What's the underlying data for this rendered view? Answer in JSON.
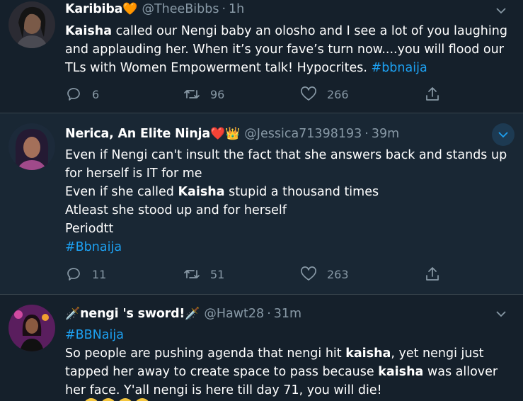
{
  "colors": {
    "background": "#15202b",
    "hover_background": "#192734",
    "text": "#ffffff",
    "muted": "#8899a6",
    "link": "#1da1f2",
    "divider": "#38444d"
  },
  "tweets": [
    {
      "name": "Karibiba",
      "name_emoji": "🧡",
      "handle": "@TheeBibbs",
      "time": "1h",
      "lines": [
        [
          "",
          "Kaisha",
          " called our Nengi baby an olosho and I see a lot of you laughing"
        ],
        [
          "and applauding her. When it’s your fave’s turn now....you will flood our",
          "",
          ""
        ],
        [
          "TLs with Women Empowerment talk! Hypocrites.  ",
          "",
          ""
        ]
      ],
      "hashtag": "#bbnaija",
      "replies": "6",
      "retweets": "96",
      "likes": "266",
      "icons": [
        "reply-icon",
        "retweet-icon",
        "like-icon",
        "share-icon",
        "chevron-down-icon"
      ]
    },
    {
      "name": "Nerica, An Elite Ninja",
      "name_emoji": "❤️",
      "name_emoji2": "👑",
      "handle": "@Jessica71398193",
      "time": "39m",
      "line1": "Even if Nengi can't insult the fact that she answers back and stands up",
      "line2": "for herself is IT for me",
      "line3_pre": "Even if she called ",
      "line3_bold": "Kaisha",
      "line3_post": " stupid a thousand times",
      "line4": "Atleast she stood up and for herself",
      "line5": "Periodtt",
      "hashtag": "#Bbnaija",
      "replies": "11",
      "retweets": "51",
      "likes": "263"
    },
    {
      "name_emoji_pre": "🗡️",
      "name": "nengi 's sword!",
      "name_emoji_post": "🗡️",
      "handle": "@Hawt28",
      "time": "31m",
      "hashtag": "#BBNaija",
      "line1_pre": "So people are pushing agenda that nengi hit ",
      "line1_bold": "kaisha",
      "line1_post": ", yet nengi just",
      "line2_pre": "tapped her away to create space to pass because ",
      "line2_bold": "kaisha",
      "line2_post": " was allover",
      "line3": "her face. Y'all nengi is here till day 71, you will die!"
    }
  ]
}
